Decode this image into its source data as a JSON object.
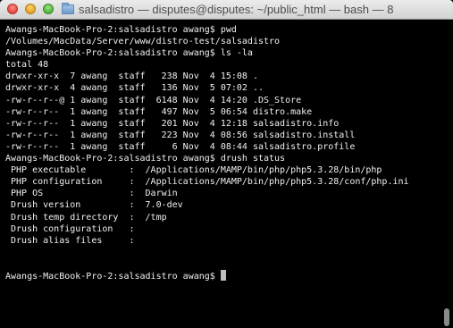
{
  "window": {
    "title": "salsadistro — disputes@disputes: ~/public_html — bash — 8"
  },
  "terminal": {
    "lines": [
      "Awangs-MacBook-Pro-2:salsadistro awang$ pwd",
      "/Volumes/MacData/Server/www/distro-test/salsadistro",
      "Awangs-MacBook-Pro-2:salsadistro awang$ ls -la",
      "total 48",
      "drwxr-xr-x  7 awang  staff   238 Nov  4 15:08 .",
      "drwxr-xr-x  4 awang  staff   136 Nov  5 07:02 ..",
      "-rw-r--r--@ 1 awang  staff  6148 Nov  4 14:20 .DS_Store",
      "-rw-r--r--  1 awang  staff   497 Nov  5 06:54 distro.make",
      "-rw-r--r--  1 awang  staff   201 Nov  4 12:18 salsadistro.info",
      "-rw-r--r--  1 awang  staff   223 Nov  4 08:56 salsadistro.install",
      "-rw-r--r--  1 awang  staff     6 Nov  4 08:44 salsadistro.profile",
      "Awangs-MacBook-Pro-2:salsadistro awang$ drush status",
      " PHP executable        :  /Applications/MAMP/bin/php/php5.3.28/bin/php",
      " PHP configuration     :  /Applications/MAMP/bin/php/php5.3.28/conf/php.ini",
      " PHP OS                :  Darwin",
      " Drush version         :  7.0-dev",
      " Drush temp directory  :  /tmp",
      " Drush configuration   :",
      " Drush alias files     :",
      "",
      ""
    ],
    "prompt": "Awangs-MacBook-Pro-2:salsadistro awang$ "
  },
  "colors": {
    "background": "#000000",
    "text": "#f0f0f0",
    "cursor": "#bfbfbf"
  },
  "icons": {
    "window_controls": [
      "close-icon",
      "minimize-icon",
      "zoom-icon"
    ],
    "title_icon": "folder-icon"
  }
}
